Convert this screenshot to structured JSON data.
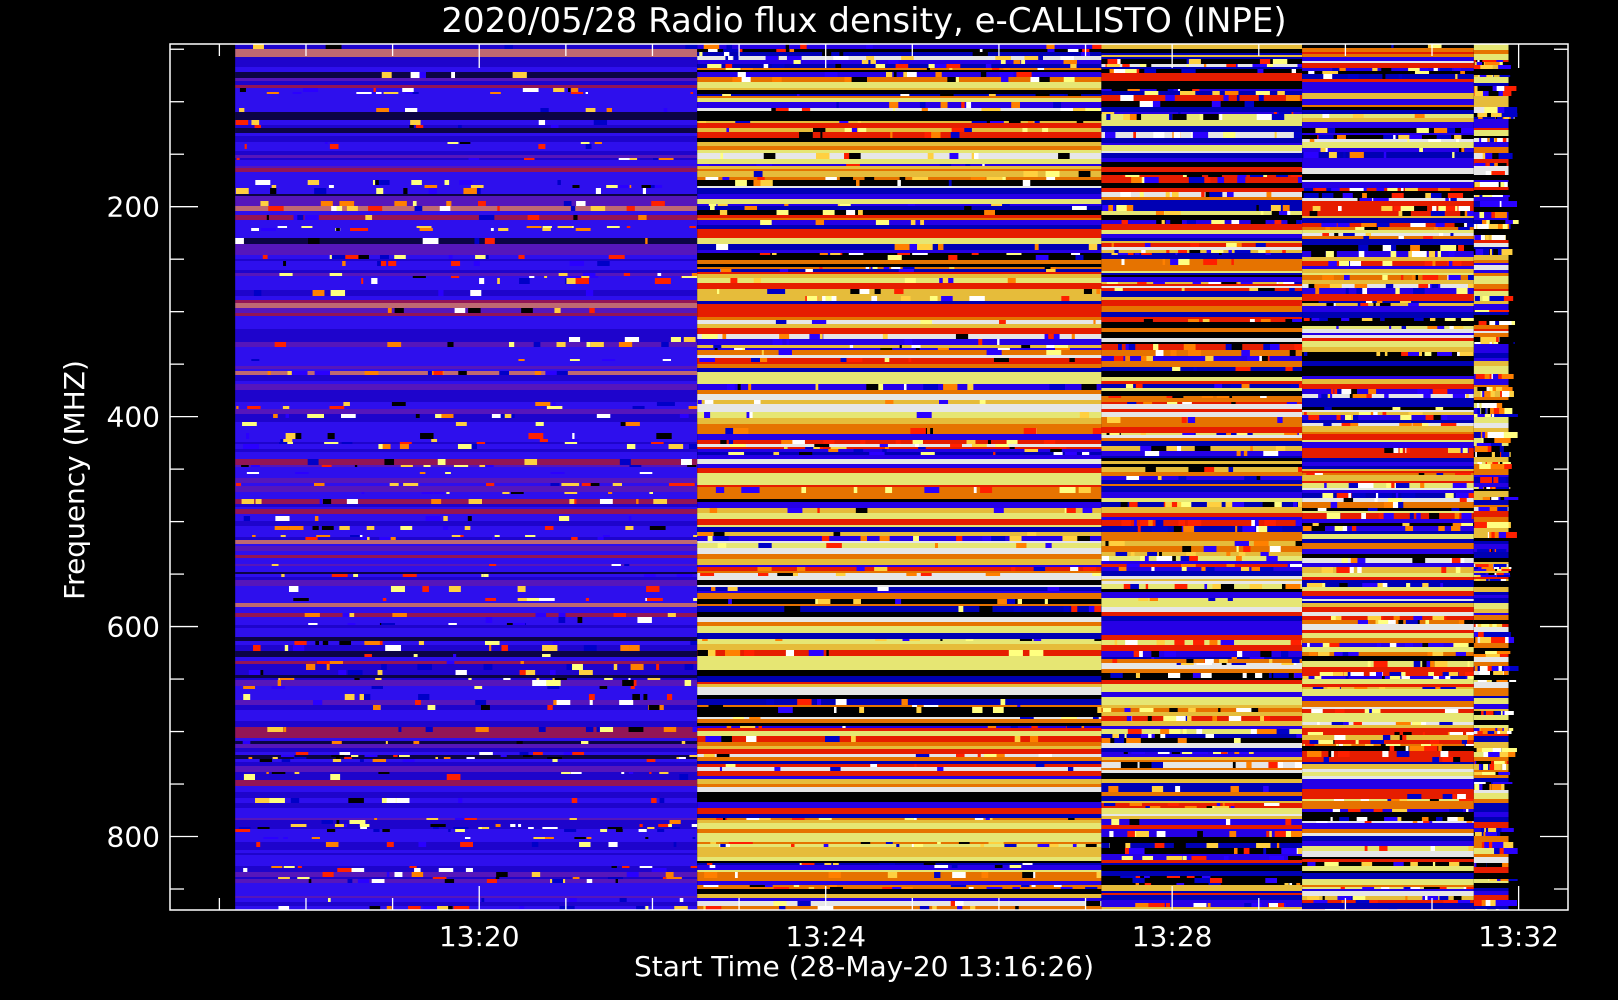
{
  "chart_data": {
    "type": "heatmap",
    "title": "2020/05/28  Radio flux density, e-CALLISTO (INPE)",
    "xlabel": "Start Time (28-May-20 13:16:26)",
    "ylabel": "Frequency (MHZ)",
    "x_ticks": [
      "13:20",
      "13:24",
      "13:28",
      "13:32"
    ],
    "y_ticks": [
      "200",
      "400",
      "600",
      "800"
    ],
    "x_range_minutes": [
      16.43,
      32.57
    ],
    "y_range_mhz": [
      45,
      870
    ],
    "data_span_minutes": [
      17.18,
      31.88
    ],
    "data_span_mhz": [
      45,
      870
    ],
    "grid": false,
    "segments": [
      {
        "start": "13:17:11",
        "end": "13:22:31",
        "level": "low"
      },
      {
        "start": "13:22:31",
        "end": "13:27:11",
        "level": "high"
      },
      {
        "start": "13:27:11",
        "end": "13:29:30",
        "level": "high"
      },
      {
        "start": "13:29:30",
        "end": "13:31:29",
        "level": "high"
      },
      {
        "start": "13:31:29",
        "end": "13:31:53",
        "level": "high"
      }
    ],
    "palette": [
      "#000000",
      "#2a00ff",
      "#0000c8",
      "#ff2000",
      "#ff8000",
      "#ffd040",
      "#ffff80",
      "#ffffff"
    ]
  }
}
